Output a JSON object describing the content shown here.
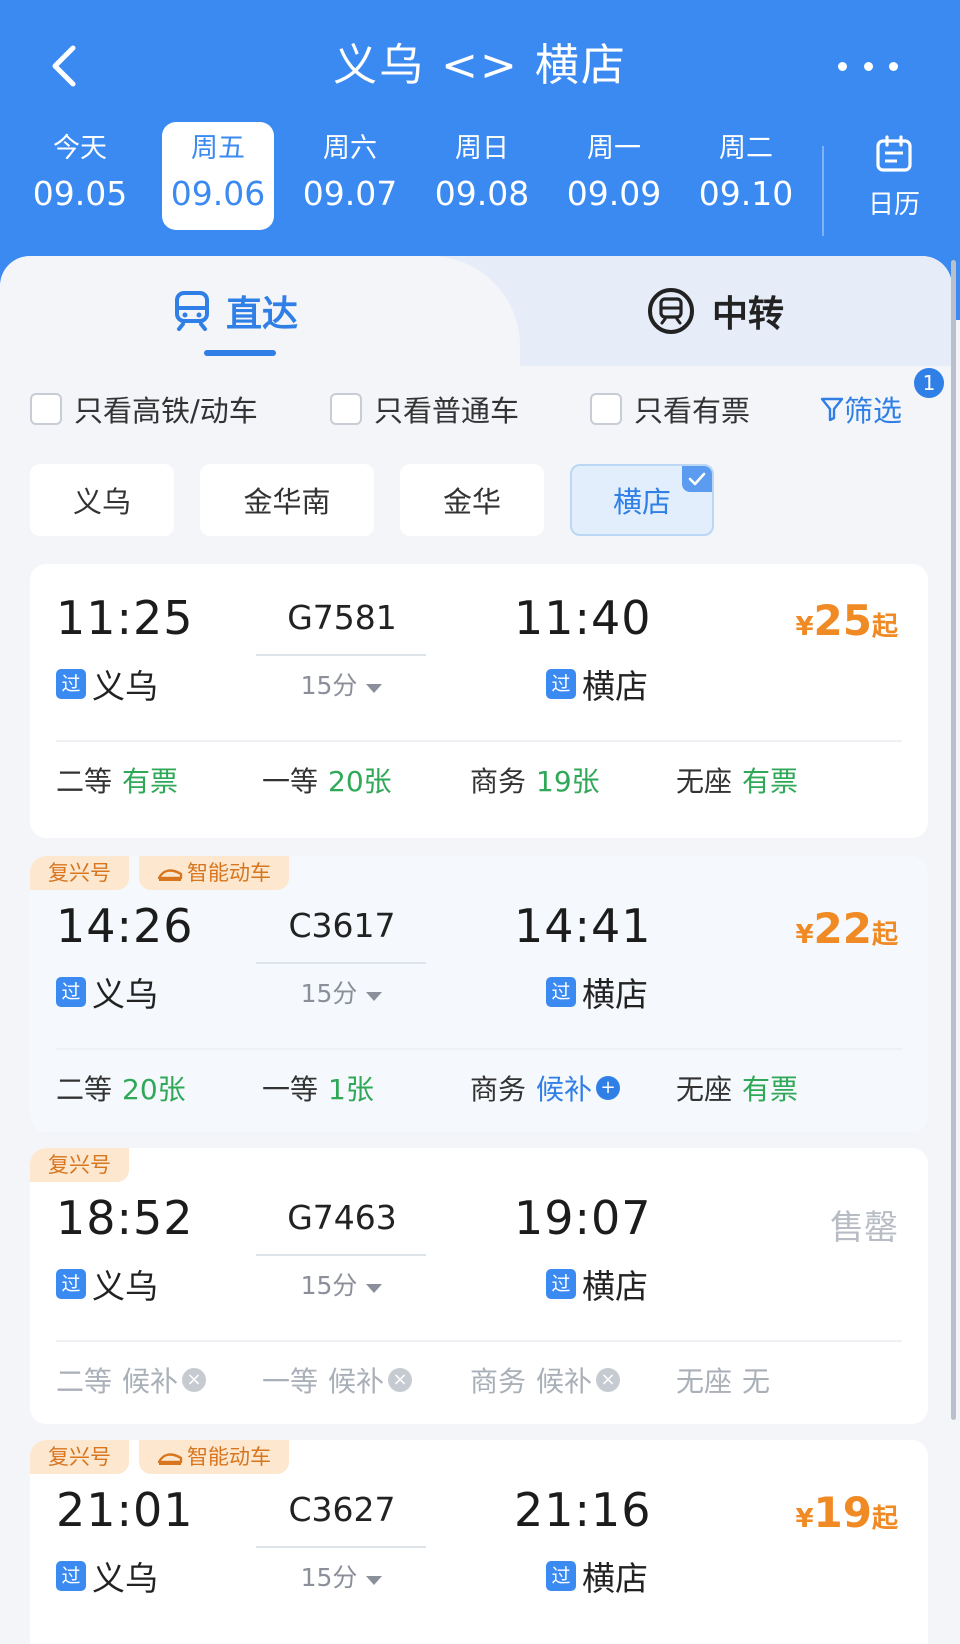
{
  "header": {
    "title": "义乌 <> 横店",
    "dates": [
      {
        "weekday": "今天",
        "date": "09.05",
        "active": false
      },
      {
        "weekday": "周五",
        "date": "09.06",
        "active": true
      },
      {
        "weekday": "周六",
        "date": "09.07",
        "active": false
      },
      {
        "weekday": "周日",
        "date": "09.08",
        "active": false
      },
      {
        "weekday": "周一",
        "date": "09.09",
        "active": false
      },
      {
        "weekday": "周二",
        "date": "09.10",
        "active": false
      }
    ],
    "calendar_label": "日历"
  },
  "tabs": {
    "direct": "直达",
    "transfer": "中转"
  },
  "filters": {
    "high_speed_only": "只看高铁/动车",
    "regular_only": "只看普通车",
    "available_only": "只看有票",
    "filter_label": "筛选",
    "filter_count": "1"
  },
  "stations": [
    {
      "name": "义乌",
      "active": false
    },
    {
      "name": "金华南",
      "active": false
    },
    {
      "name": "金华",
      "active": false
    },
    {
      "name": "横店",
      "active": true
    }
  ],
  "trains": [
    {
      "badges": [],
      "dep_time": "11:25",
      "dep_station": "义乌",
      "pass_label": "过",
      "train_no": "G7581",
      "duration": "15分",
      "arr_time": "11:40",
      "arr_station": "横店",
      "price_currency": "¥",
      "price_value": "25",
      "price_suffix": "起",
      "seats": [
        {
          "cls": "二等",
          "status": "有票"
        },
        {
          "cls": "一等",
          "status": "20张"
        },
        {
          "cls": "商务",
          "status": "19张"
        },
        {
          "cls": "无座",
          "status": "有票"
        }
      ]
    },
    {
      "badges": [
        "复兴号",
        "智能动车"
      ],
      "dep_time": "14:26",
      "dep_station": "义乌",
      "pass_label": "过",
      "train_no": "C3617",
      "duration": "15分",
      "arr_time": "14:41",
      "arr_station": "横店",
      "price_currency": "¥",
      "price_value": "22",
      "price_suffix": "起",
      "seats": [
        {
          "cls": "二等",
          "status": "20张"
        },
        {
          "cls": "一等",
          "status": "1张"
        },
        {
          "cls": "商务",
          "status": "候补"
        },
        {
          "cls": "无座",
          "status": "有票"
        }
      ]
    },
    {
      "badges": [
        "复兴号"
      ],
      "dep_time": "18:52",
      "dep_station": "义乌",
      "pass_label": "过",
      "train_no": "G7463",
      "duration": "15分",
      "arr_time": "19:07",
      "arr_station": "横店",
      "sold_out": "售罄",
      "seats": [
        {
          "cls": "二等",
          "status": "候补"
        },
        {
          "cls": "一等",
          "status": "候补"
        },
        {
          "cls": "商务",
          "status": "候补"
        },
        {
          "cls": "无座",
          "status": "无"
        }
      ]
    },
    {
      "badges": [
        "复兴号",
        "智能动车"
      ],
      "dep_time": "21:01",
      "dep_station": "义乌",
      "pass_label": "过",
      "train_no": "C3627",
      "duration": "15分",
      "arr_time": "21:16",
      "arr_station": "横店",
      "price_currency": "¥",
      "price_value": "19",
      "price_suffix": "起"
    }
  ],
  "colors": {
    "brand_blue": "#3b8af2",
    "price_orange": "#f08a24",
    "available_green": "#2fa857",
    "badge_bg": "#fde8cf"
  }
}
